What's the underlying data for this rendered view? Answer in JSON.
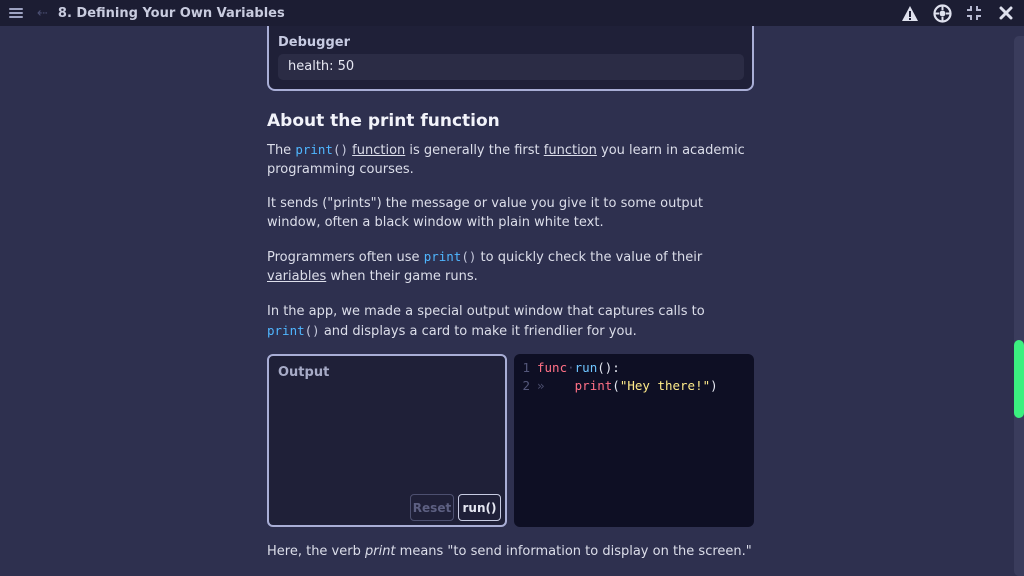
{
  "header": {
    "title": "8. Defining Your Own Variables",
    "icons": [
      "menu-icon",
      "back-arrow-icon",
      "warning-icon",
      "settings-gear-icon",
      "fullscreen-icon",
      "close-icon"
    ]
  },
  "debugger": {
    "label": "Debugger",
    "value": "health: 50"
  },
  "lesson": {
    "heading": "About the print function",
    "p1": {
      "code": "print",
      "paren": "()",
      "t1": " ",
      "link1": "function",
      "t2": " is generally the first ",
      "link2": "function",
      "t3": " you learn in academic programming courses.",
      "prefix": "The "
    },
    "p2": "It sends (\"prints\") the message or value you give it to some output window, often a black window with plain white text.",
    "p3": {
      "t1": "Programmers often use ",
      "code": "print",
      "paren": "()",
      "t2": " to quickly check the value of their ",
      "link": "variables",
      "t3": " when their game runs."
    },
    "p4": {
      "t1": "In the app, we made a special output window that captures calls to ",
      "code": "print",
      "paren": "()",
      "t2": " and displays a card to make it friendlier for you."
    },
    "p5": {
      "t1": "Here, the verb ",
      "em": "print",
      "t2": " means \"to send information to display on the screen.\""
    }
  },
  "output_panel": {
    "label": "Output",
    "reset_label": "Reset",
    "run_label": "run()"
  },
  "code_editor": {
    "line1": {
      "num": "1",
      "kw": "func",
      "dot": "·",
      "fn": "run",
      "rest": "():"
    },
    "line2": {
      "num": "2",
      "dot": "»",
      "fn": "print",
      "open": "(",
      "str": "\"Hey there!\"",
      "close": ")"
    }
  },
  "colors": {
    "background": "#2e304f",
    "topbar": "#1c1d33",
    "code_blue": "#4fb6ff",
    "scroll_thumb": "#3bf07f"
  }
}
